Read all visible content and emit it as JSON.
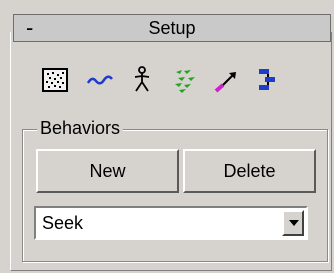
{
  "rollout": {
    "collapse_symbol": "-",
    "title": "Setup"
  },
  "toolbar": {
    "tools": [
      {
        "name": "display-field-tool",
        "icon": "dotted-grid-icon"
      },
      {
        "name": "path-tool",
        "icon": "wave-icon"
      },
      {
        "name": "biped-tool",
        "icon": "walking-figure-icon"
      },
      {
        "name": "crowd-tool",
        "icon": "green-arrows-icon"
      },
      {
        "name": "vector-tool",
        "icon": "magenta-arrow-icon"
      },
      {
        "name": "link-tool",
        "icon": "hierarchy-icon"
      }
    ]
  },
  "behaviors": {
    "group_label": "Behaviors",
    "new_label": "New",
    "delete_label": "Delete",
    "selected": "Seek"
  }
}
